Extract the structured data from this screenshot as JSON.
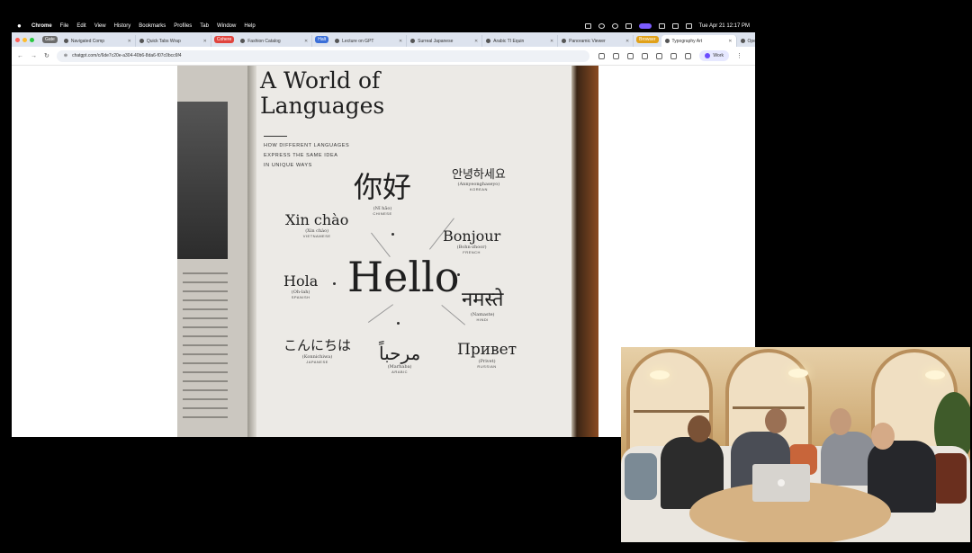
{
  "menubar": {
    "items": [
      "Chrome",
      "File",
      "Edit",
      "View",
      "History",
      "Bookmarks",
      "Profiles",
      "Tab",
      "Window",
      "Help"
    ],
    "clock": "Tue Apr 21  12:17 PM"
  },
  "browser": {
    "tabs": [
      {
        "group": "Gate",
        "group_color": "#6b6b6b",
        "label": "Navigated Comp"
      },
      {
        "label": "Quick Tabs Wrap"
      },
      {
        "group": "Cohere",
        "group_color": "#e0443e",
        "label": "Fashion Catalog"
      },
      {
        "group": "Halt",
        "group_color": "#3b6fd8",
        "label": "Lecture on GPT"
      },
      {
        "label": "Surreal Japanese"
      },
      {
        "label": "Arabic TI Equin"
      },
      {
        "label": "Panoramic Viewer"
      },
      {
        "group": "Browser",
        "group_color": "#e0a11a",
        "label": "Typography Art",
        "active": true
      },
      {
        "label": "OpenAI Board"
      }
    ],
    "url": "chatgpt.com/c/6de7c20e-a304-40b6-8da6-f07c0bcc6f4",
    "profile_label": "Work"
  },
  "magazine": {
    "title_line1": "A World of",
    "title_line2": "Languages",
    "subtitle_lines": [
      "HOW DIFFERENT LANGUAGES",
      "EXPRESS THE SAME IDEA",
      "IN UNIQUE WAYS"
    ],
    "center_word": "Hello",
    "greetings": [
      {
        "word": "你好",
        "romanization": "(Nǐ hǎo)",
        "language": "CHINESE"
      },
      {
        "word": "안녕하세요",
        "romanization": "(Annyeonghaseyo)",
        "language": "KOREAN"
      },
      {
        "word": "Xin chào",
        "romanization": "(Xin chào)",
        "language": "VIETNAMESE"
      },
      {
        "word": "Bonjour",
        "romanization": "(Bohn-zhoor)",
        "language": "FRENCH"
      },
      {
        "word": "Hola",
        "romanization": "(Oh-lah)",
        "language": "SPANISH"
      },
      {
        "word": "नमस्ते",
        "romanization": "(Namaste)",
        "language": "HINDI"
      },
      {
        "word": "こんにちは",
        "romanization": "(Konnichiwa)",
        "language": "JAPANESE"
      },
      {
        "word": "مرحباً",
        "romanization": "(Marhaba)",
        "language": "ARABIC"
      },
      {
        "word": "Привет",
        "romanization": "(Privet)",
        "language": "RUSSIAN"
      }
    ]
  }
}
